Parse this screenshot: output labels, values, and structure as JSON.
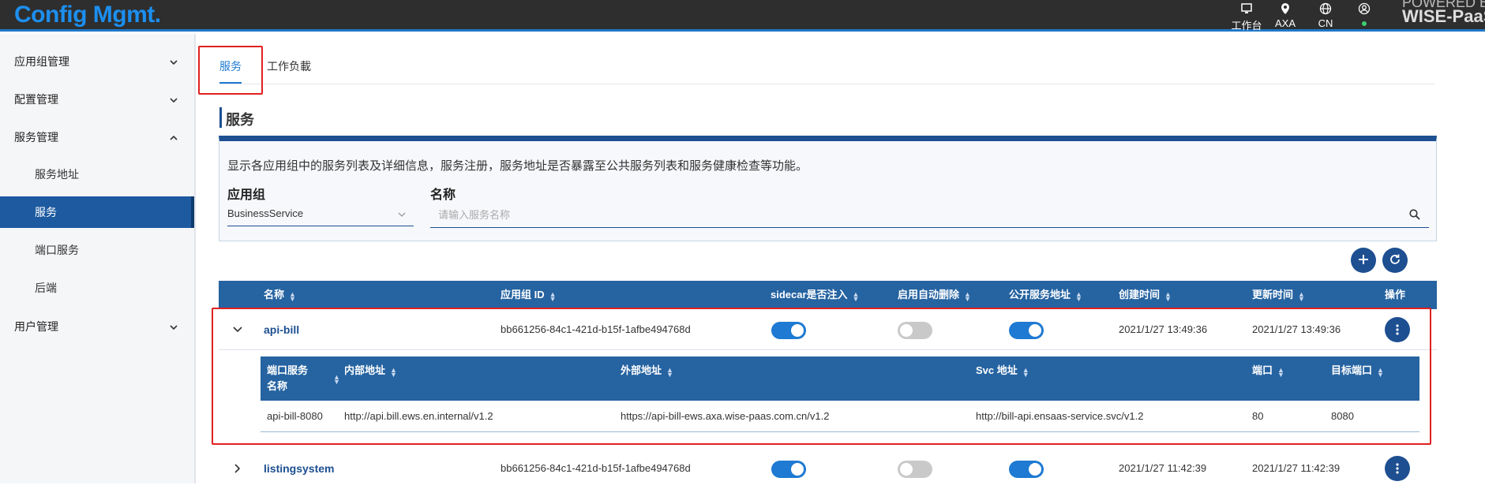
{
  "app": {
    "brand": "Config Mgmt."
  },
  "topbar": {
    "items": [
      {
        "label": "工作台",
        "icon": "monitor-icon"
      },
      {
        "label": "AXA",
        "icon": "location-pin-icon"
      },
      {
        "label": "CN",
        "icon": "globe-icon"
      },
      {
        "label": "",
        "icon": "user-icon"
      }
    ],
    "powered_line1": "POWERED BY",
    "powered_line2": "WISE-PaaS"
  },
  "sidebar": {
    "groups": [
      {
        "label": "应用组管理",
        "expanded": false
      },
      {
        "label": "配置管理",
        "expanded": false
      },
      {
        "label": "服务管理",
        "expanded": true
      },
      {
        "label": "用户管理",
        "expanded": false
      }
    ],
    "sub_items": [
      {
        "label": "服务地址",
        "active": false
      },
      {
        "label": "服务",
        "active": true
      },
      {
        "label": "端口服务",
        "active": false
      },
      {
        "label": "后端",
        "active": false
      }
    ]
  },
  "tabs": [
    {
      "label": "服务",
      "active": true
    },
    {
      "label": "工作负載",
      "active": false
    }
  ],
  "section": {
    "title": "服务",
    "description": "显示各应用组中的服务列表及详细信息，服务注册，服务地址是否暴露至公共服务列表和服务健康检查等功能。",
    "app_group_label": "应用组",
    "app_group_value": "BusinessService",
    "name_label": "名称",
    "name_placeholder": "请输入服务名称"
  },
  "table": {
    "columns": [
      "名称",
      "应用组 ID",
      "sidecar是否注入",
      "启用自动删除",
      "公开服务地址",
      "创建时间",
      "更新时间",
      "操作"
    ],
    "rows": [
      {
        "name": "api-bill",
        "app_group_id": "bb661256-84c1-421d-b15f-1afbe494768d",
        "sidecar": true,
        "auto_delete": false,
        "public_address": true,
        "created": "2021/1/27 13:49:36",
        "updated": "2021/1/27 13:49:36",
        "expanded": true
      },
      {
        "name": "listingsystem",
        "app_group_id": "bb661256-84c1-421d-b15f-1afbe494768d",
        "sidecar": true,
        "auto_delete": false,
        "public_address": true,
        "created": "2021/1/27 11:42:39",
        "updated": "2021/1/27 11:42:39",
        "expanded": false
      }
    ]
  },
  "nested": {
    "columns": [
      "端口服务\n名称",
      "内部地址",
      "外部地址",
      "Svc 地址",
      "端口",
      "目标端口"
    ],
    "col_name_line1": "端口服务",
    "col_name_line2": "名称",
    "rows": [
      {
        "name": "api-bill-8080",
        "internal": "http://api.bill.ews.en.internal/v1.2",
        "external": "https://api-bill-ews.axa.wise-paas.com.cn/v1.2",
        "svc": "http://bill-api.ensaas-service.svc/v1.2",
        "port": "80",
        "target_port": "8080"
      }
    ]
  },
  "colors": {
    "primary": "#1d4f91",
    "header": "#2563a1",
    "accent": "#1e7ad2",
    "highlight": "#e02020"
  }
}
